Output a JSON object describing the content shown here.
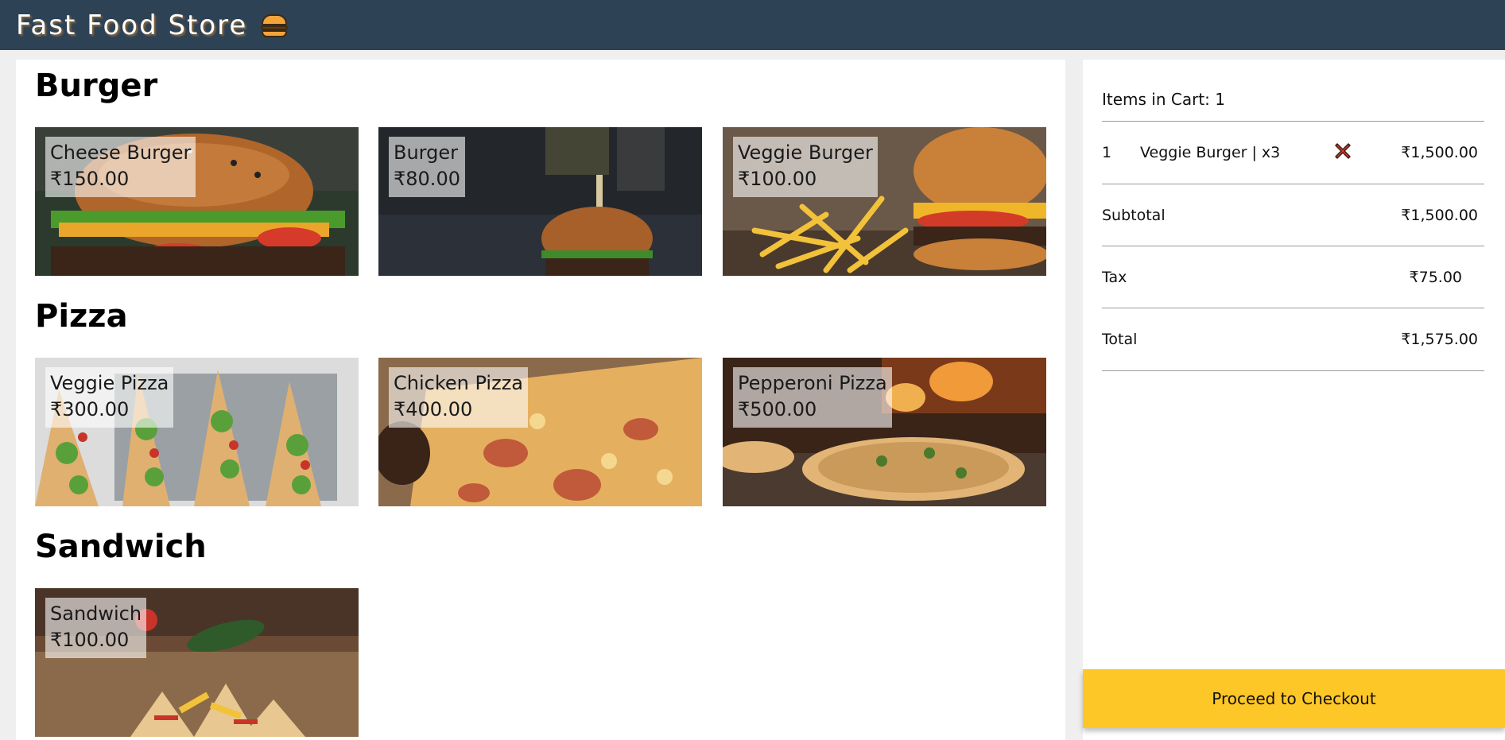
{
  "header": {
    "title": "Fast Food Store",
    "logo_icon": "burger-icon",
    "background": "#2e4256"
  },
  "menu": {
    "categories": [
      {
        "name": "Burger",
        "items": [
          {
            "name": "Cheese Burger",
            "price": "₹150.00"
          },
          {
            "name": "Burger",
            "price": "₹80.00"
          },
          {
            "name": "Veggie Burger",
            "price": "₹100.00"
          }
        ]
      },
      {
        "name": "Pizza",
        "items": [
          {
            "name": "Veggie Pizza",
            "price": "₹300.00"
          },
          {
            "name": "Chicken Pizza",
            "price": "₹400.00"
          },
          {
            "name": "Pepperoni Pizza",
            "price": "₹500.00"
          }
        ]
      },
      {
        "name": "Sandwich",
        "items": [
          {
            "name": "Sandwich",
            "price": "₹100.00"
          }
        ]
      }
    ]
  },
  "cart": {
    "items_label": "Items in Cart: 1",
    "items": [
      {
        "index": "1",
        "name": "Veggie Burger | x3",
        "amount": "₹1,500.00",
        "remove_icon": "close-icon"
      }
    ],
    "subtotal_label": "Subtotal",
    "subtotal": "₹1,500.00",
    "tax_label": "Tax",
    "tax": "₹75.00",
    "total_label": "Total",
    "total": "₹1,575.00",
    "checkout_label": "Proceed to Checkout",
    "checkout_color": "#fdc727"
  }
}
